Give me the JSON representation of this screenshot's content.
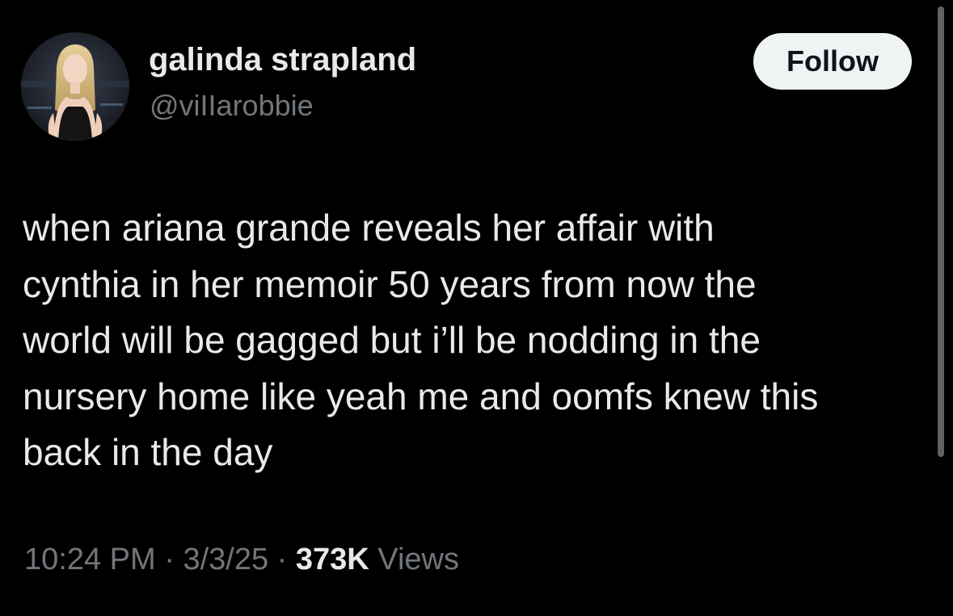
{
  "author": {
    "display_name": "galinda strapland",
    "handle": "@viIIarobbie",
    "avatar_icon": "profile-photo"
  },
  "follow_button": {
    "label": "Follow"
  },
  "tweet": {
    "lines": [
      "when ariana grande reveals her affair with",
      "cynthia in her memoir 50 years from now the",
      "world will be gagged but i’ll be nodding in the",
      "nursery home like yeah me and oomfs knew this",
      "back in the day"
    ]
  },
  "meta": {
    "time": "10:24 PM",
    "separator": "·",
    "date": "3/3/25",
    "views_count": "373K",
    "views_label": "Views"
  },
  "colors": {
    "background": "#000000",
    "text_primary": "#e7e9ea",
    "text_secondary": "#71767b",
    "follow_bg": "#eff3f4",
    "follow_text": "#0f1419"
  }
}
